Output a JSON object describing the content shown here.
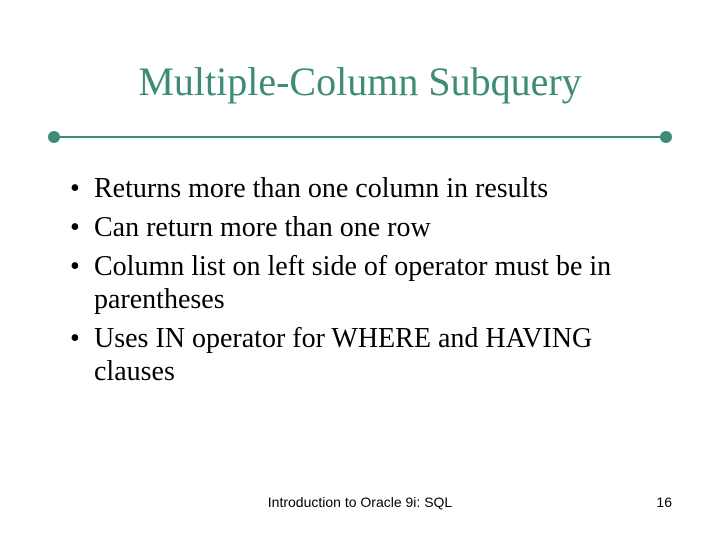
{
  "title": "Multiple-Column Subquery",
  "bullets": [
    "Returns more than one column in results",
    "Can return more than one row",
    "Column list on left side of operator must be in parentheses",
    "Uses IN operator for WHERE and HAVING clauses"
  ],
  "footer": {
    "center": "Introduction to Oracle 9i: SQL",
    "page": "16"
  }
}
